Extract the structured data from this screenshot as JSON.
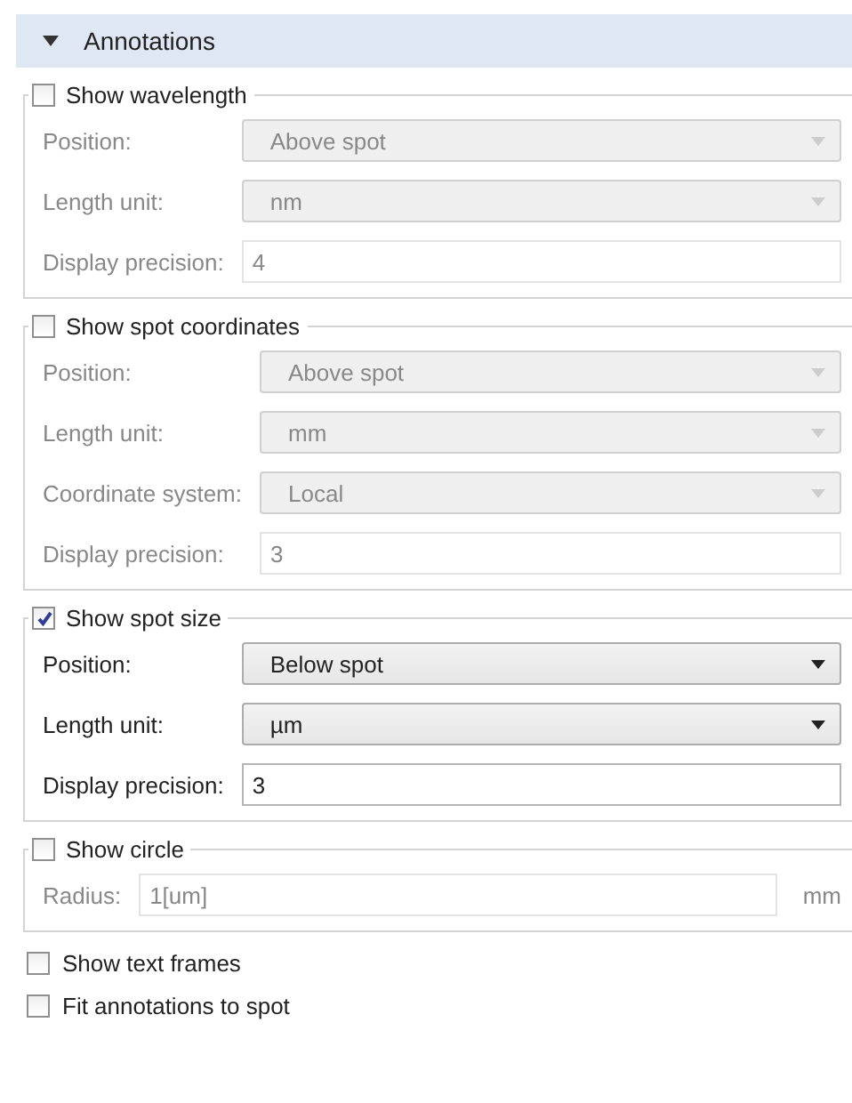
{
  "section": {
    "title": "Annotations",
    "expanded": true
  },
  "groups": [
    {
      "label": "Show wavelength",
      "checked": false,
      "fields": [
        {
          "kind": "select",
          "label": "Position:",
          "value": "Above spot"
        },
        {
          "kind": "select",
          "label": "Length unit:",
          "value": "nm"
        },
        {
          "kind": "text",
          "label": "Display precision:",
          "value": "4"
        }
      ]
    },
    {
      "label": "Show spot coordinates",
      "checked": false,
      "fields": [
        {
          "kind": "select",
          "label": "Position:",
          "value": "Above spot"
        },
        {
          "kind": "select",
          "label": "Length unit:",
          "value": "mm"
        },
        {
          "kind": "select",
          "label": "Coordinate system:",
          "value": "Local"
        },
        {
          "kind": "text",
          "label": "Display precision:",
          "value": "3"
        }
      ]
    },
    {
      "label": "Show spot size",
      "checked": true,
      "fields": [
        {
          "kind": "select",
          "label": "Position:",
          "value": "Below spot"
        },
        {
          "kind": "select",
          "label": "Length unit:",
          "value": "µm"
        },
        {
          "kind": "text",
          "label": "Display precision:",
          "value": "3"
        }
      ]
    },
    {
      "label": "Show circle",
      "checked": false,
      "fields": [
        {
          "kind": "text",
          "label": "Radius:",
          "value": "1[um]",
          "unit": "mm"
        }
      ]
    }
  ],
  "options": [
    {
      "label": "Show text frames",
      "checked": false
    },
    {
      "label": "Fit annotations to spot",
      "checked": false
    }
  ]
}
